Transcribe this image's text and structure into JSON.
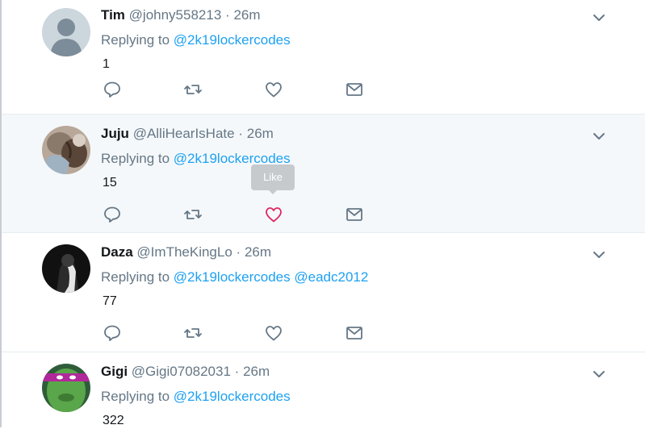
{
  "tweets": [
    {
      "name": "Tim",
      "handle": "@johny558213",
      "separator": "·",
      "time": "26m",
      "replying_prefix": "Replying to",
      "mentions": [
        "@2k19lockercodes"
      ],
      "text": "1",
      "avatar_icon": "default-avatar-icon"
    },
    {
      "name": "Juju",
      "handle": "@AlliHearIsHate",
      "separator": "·",
      "time": "26m",
      "replying_prefix": "Replying to",
      "mentions": [
        "@2k19lockercodes"
      ],
      "text": "15",
      "like_hovered": true,
      "avatar_icon": "photo-avatar-icon"
    },
    {
      "name": "Daza",
      "handle": "@ImTheKingLo",
      "separator": "·",
      "time": "26m",
      "replying_prefix": "Replying to",
      "mentions": [
        "@2k19lockercodes",
        "@eadc2012"
      ],
      "text": "77",
      "avatar_icon": "dark-photo-avatar-icon"
    },
    {
      "name": "Gigi",
      "handle": "@Gigi07082031",
      "separator": "·",
      "time": "26m",
      "replying_prefix": "Replying to",
      "mentions": [
        "@2k19lockercodes"
      ],
      "text": "322",
      "avatar_icon": "green-face-avatar-icon"
    }
  ],
  "tooltip": {
    "like_label": "Like"
  },
  "colors": {
    "link": "#1da1f2",
    "secondary_text": "#657786",
    "icon": "#657786",
    "like_hover": "#e0245e",
    "hover_bg": "#f5f8fa",
    "divider": "#e6ecf0"
  },
  "icons": {
    "caret": "chevron-down-icon",
    "reply": "reply-icon",
    "retweet": "retweet-icon",
    "like": "heart-icon",
    "dm": "envelope-icon"
  }
}
